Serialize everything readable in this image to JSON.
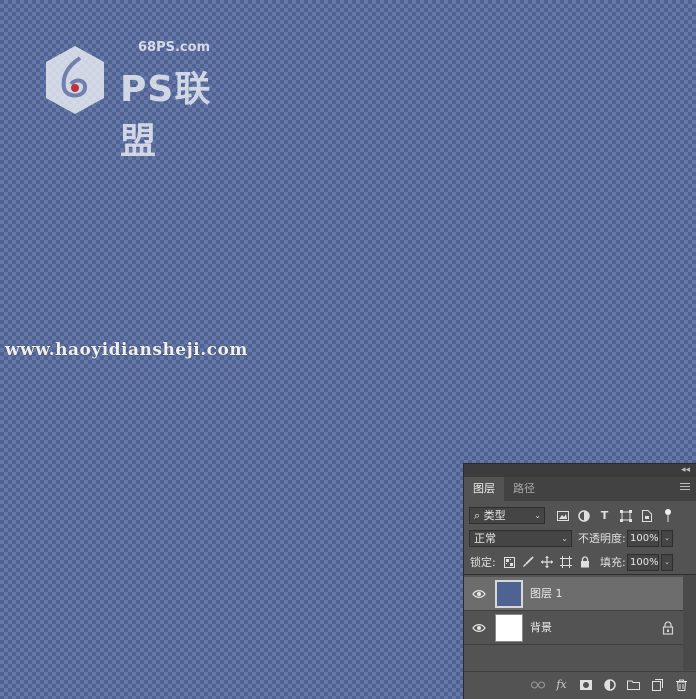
{
  "watermark": {
    "domain": "68PS.com",
    "brand": "PS联盟",
    "url": "www.haoyidiansheji.com"
  },
  "layers_panel": {
    "tabs": [
      {
        "label": "图层",
        "active": true
      },
      {
        "label": "路径",
        "active": false
      }
    ],
    "filter": {
      "label": "类型",
      "search_icon": "search-icon"
    },
    "filter_icons": [
      "image-filter-icon",
      "adjustment-filter-icon",
      "text-filter-icon",
      "shape-filter-icon",
      "smart-object-filter-icon",
      "filter-toggle-icon"
    ],
    "blend_mode": "正常",
    "opacity_label": "不透明度:",
    "opacity_value": "100%",
    "lock_label": "锁定:",
    "lock_icons": [
      "lock-transparent-pixels-icon",
      "lock-image-pixels-icon",
      "lock-position-icon",
      "lock-artboard-icon",
      "lock-all-icon"
    ],
    "fill_label": "填充:",
    "fill_value": "100%",
    "layers": [
      {
        "name": "图层 1",
        "selected": true,
        "visible": true,
        "thumb_color": "#4e6392",
        "locked": false
      },
      {
        "name": "背景",
        "selected": false,
        "visible": true,
        "thumb_color": "#ffffff",
        "locked": true
      }
    ],
    "bottom_icons": [
      "link-layers-icon",
      "fx-icon",
      "add-mask-icon",
      "adjustment-layer-icon",
      "new-group-icon",
      "new-layer-icon",
      "delete-icon"
    ],
    "fx_label": "fx"
  },
  "colors": {
    "canvas_bg": "#4e6392",
    "checker_light": "#6677a8",
    "panel_bg": "#535353"
  }
}
